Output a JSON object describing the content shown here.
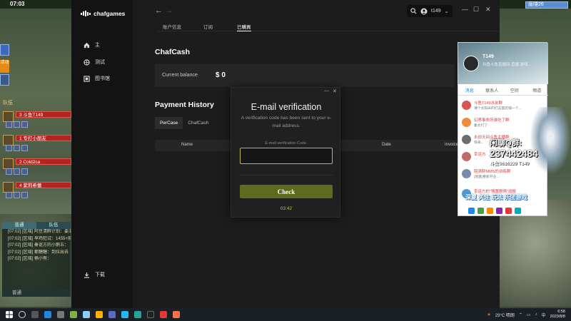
{
  "game": {
    "time": "07:03",
    "topright_label": "唐隱26",
    "side_label": "活动",
    "party_header": "队伍",
    "party": [
      {
        "name": "3 斗鱼T149"
      },
      {
        "name": "1 专打小朋友"
      },
      {
        "name": "2 Cold2ca"
      },
      {
        "name": "4 紫莉希蕾"
      }
    ],
    "chat_tabs": [
      "普通",
      "队伍"
    ],
    "chat_lines": [
      "[07:02] [区域] 阿豆清醉计划：要消",
      "[07:02] [区域] 早鸡犯试：1455+前",
      "[07:02] [区域] 秦讴方的小鹅五：",
      "[07:02] [区域] 都糖糖：到拉出去",
      "[07:02] [区域] 楠小熊："
    ],
    "chat_input": "普通"
  },
  "app": {
    "brand": "chafgames",
    "nav": [
      {
        "label": "主",
        "icon": "home-icon"
      },
      {
        "label": "测试",
        "icon": "globe-icon"
      },
      {
        "label": "图书馆",
        "icon": "library-icon"
      }
    ],
    "nav_bottom": {
      "label": "下载",
      "icon": "download-icon"
    },
    "user": "t149",
    "tabs": [
      "账户信息",
      "订阅",
      "已購買"
    ],
    "active_tab": 2,
    "chafcash_title": "ChafCash",
    "balance_label": "Current balance",
    "balance_value": "$ 0",
    "history_title": "Payment History",
    "history_tabs": [
      "PerCase",
      "ChafCash"
    ],
    "table_headers": [
      "Name",
      "Date",
      "Invoice"
    ]
  },
  "modal": {
    "title": "E-mail verification",
    "description": "A verification code has been sent to your e-mail address.",
    "field_label": "E-mail verification Code.",
    "input_value": "",
    "button_label": "Check",
    "timer": "03:42",
    "accent": "#c5b350",
    "button_color": "#5f6a1f"
  },
  "qq": {
    "name": "T149",
    "status": "抖鱼斗鱼直播间 直播 游戏...",
    "tabs": [
      "消息",
      "联系人",
      "空间",
      "频道"
    ],
    "messages": [
      {
        "name": "斗鱼T149水友群",
        "text": "薄个太阳米的打击量店铺一个..."
      },
      {
        "name": "幻界事务所谁吃了群",
        "text": "集太打了"
      },
      {
        "name": "永劫无间斗鱼主播群",
        "text": "快来..."
      },
      {
        "name": "幸运方",
        "text": "..."
      },
      {
        "name": "陪清醉MMS的训练群",
        "text": "[地盘]重新开业..."
      },
      {
        "name": "幸运方的\"情置剧情\"战报",
        "text": "..."
      }
    ],
    "group_line1": "闲聊Q群:",
    "group_line2": "237442484",
    "group_line3": "斗鱼9616229 T149",
    "banner": "深夏   关注   玩法   乐团游戏"
  },
  "taskbar": {
    "weather": "29°C 晴朗",
    "lang": "中",
    "time": "6:58",
    "date": "2023/8/8"
  }
}
